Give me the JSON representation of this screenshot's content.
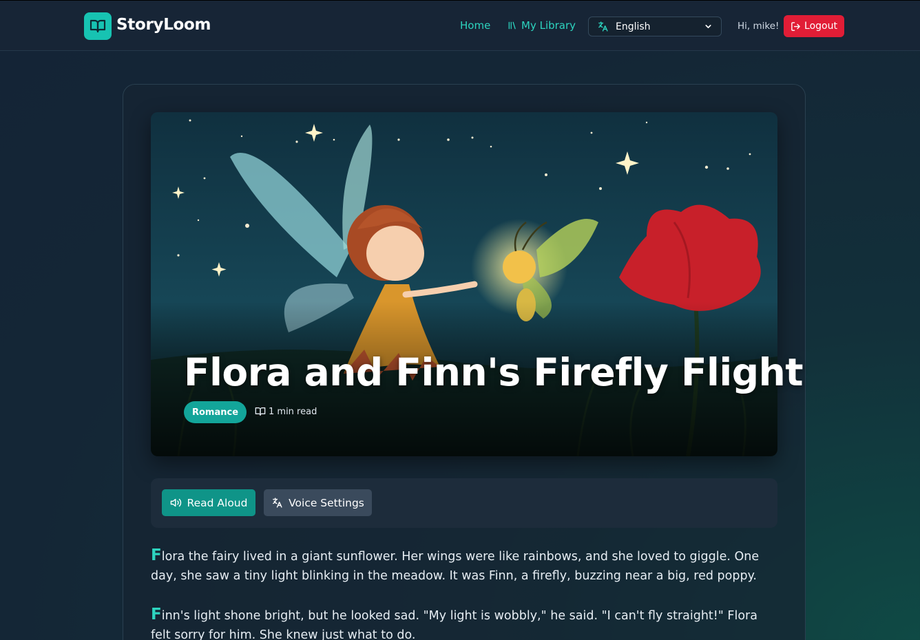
{
  "app": {
    "name": "StoryLoom",
    "colors": {
      "accent": "#2dd4bf",
      "logo": "#17c3b2",
      "danger": "#e11d36",
      "badge": "#13a59a"
    }
  },
  "nav": {
    "home": "Home",
    "library": "My Library",
    "language": "English",
    "greeting": "Hi, mike!",
    "logout": "Logout"
  },
  "story": {
    "title": "Flora and Finn's Firefly Flight",
    "genre": "Romance",
    "read_time": "1 min read",
    "paragraphs": [
      {
        "first": "F",
        "rest": "lora the fairy lived in a giant sunflower. Her wings were like rainbows, and she loved to giggle. One day, she saw a tiny light blinking in the meadow. It was Finn, a firefly, buzzing near a big, red poppy."
      },
      {
        "first": "F",
        "rest": "inn's light shone bright, but he looked sad. \"My light is wobbly,\" he said. \"I can't fly straight!\" Flora felt sorry for him. She knew just what to do."
      }
    ]
  },
  "controls": {
    "read_aloud": "Read Aloud",
    "voice_settings": "Voice Settings"
  }
}
